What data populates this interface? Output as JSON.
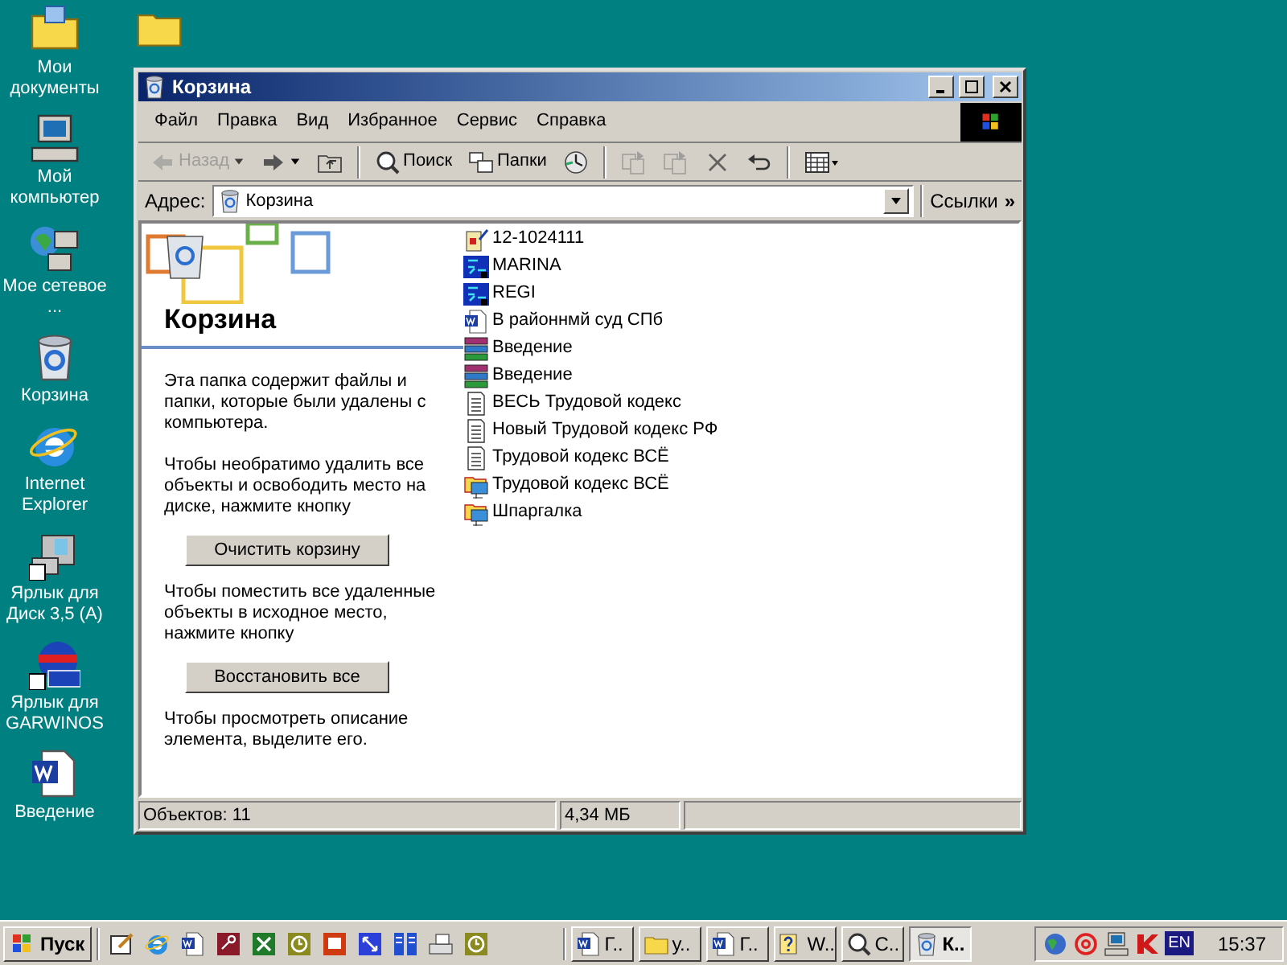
{
  "desktop_icons": [
    {
      "label": "Мои документы",
      "kind": "documents"
    },
    {
      "label": "Мой компьютер",
      "kind": "computer"
    },
    {
      "label": "Мое сетевое ...",
      "kind": "network"
    },
    {
      "label": "Корзина",
      "kind": "recycle"
    },
    {
      "label": "Internet Explorer",
      "kind": "ie"
    },
    {
      "label": "Ярлык для Диск 3,5 (A)",
      "kind": "floppy"
    },
    {
      "label": "Ярлык для GARWINOS",
      "kind": "garant"
    },
    {
      "label": "Введение",
      "kind": "word"
    }
  ],
  "desktop_folder": {
    "kind": "folder"
  },
  "window": {
    "title": "Корзина",
    "menu": [
      "Файл",
      "Правка",
      "Вид",
      "Избранное",
      "Сервис",
      "Справка"
    ],
    "toolbar": [
      {
        "kind": "back",
        "label": "Назад",
        "disabled": true
      },
      {
        "kind": "forward",
        "disabled": false
      },
      {
        "kind": "up",
        "disabled": false
      },
      {
        "kind": "sep"
      },
      {
        "kind": "search",
        "label": "Поиск",
        "disabled": false
      },
      {
        "kind": "folders",
        "label": "Папки",
        "disabled": false
      },
      {
        "kind": "history",
        "disabled": false
      },
      {
        "kind": "sep"
      },
      {
        "kind": "moveto",
        "disabled": true
      },
      {
        "kind": "copyto",
        "disabled": true
      },
      {
        "kind": "delete",
        "disabled": true
      },
      {
        "kind": "undo",
        "disabled": false
      },
      {
        "kind": "sep"
      },
      {
        "kind": "views",
        "disabled": false
      }
    ],
    "address": {
      "label": "Адрес:",
      "value": "Корзина"
    },
    "links": "Ссылки",
    "links_chevron": "»",
    "panel": {
      "heading": "Корзина",
      "blocks": [
        {
          "kind": "text",
          "text": "Эта папка содержит файлы и папки, которые были удалены с компьютера."
        },
        {
          "kind": "text",
          "text": "Чтобы необратимо удалить все объекты и освободить место на диске, нажмите кнопку"
        },
        {
          "kind": "button",
          "text": "Очистить корзину"
        },
        {
          "kind": "text",
          "text": "Чтобы поместить все удаленные объекты в исходное место, нажмите кнопку"
        },
        {
          "kind": "button",
          "text": "Восстановить все"
        },
        {
          "kind": "text",
          "text": "Чтобы просмотреть описание элемента, выделите его."
        }
      ]
    },
    "files": [
      {
        "name": "12-1024111",
        "kind": "shortcut"
      },
      {
        "name": "MARINA",
        "kind": "app"
      },
      {
        "name": "REGI",
        "kind": "app"
      },
      {
        "name": "В районнмй суд СПб",
        "kind": "word"
      },
      {
        "name": "Введение",
        "kind": "archive"
      },
      {
        "name": "Введение",
        "kind": "archive"
      },
      {
        "name": "ВЕСЬ Трудовой кодекс",
        "kind": "text"
      },
      {
        "name": "Новый Трудовой кодекс РФ",
        "kind": "text"
      },
      {
        "name": "Трудовой кодекс ВСЁ",
        "kind": "text"
      },
      {
        "name": "Трудовой кодекс ВСЁ",
        "kind": "netfolder"
      },
      {
        "name": "Шпаргалка",
        "kind": "netfolder"
      }
    ],
    "status": [
      "Объектов: 11",
      "4,34 МБ"
    ]
  },
  "taskbar": {
    "start": "Пуск",
    "quick_launch": [
      {
        "kind": "desktop"
      },
      {
        "kind": "ie"
      },
      {
        "kind": "word"
      },
      {
        "kind": "access"
      },
      {
        "kind": "excel"
      },
      {
        "kind": "clock"
      },
      {
        "kind": "powerpoint"
      },
      {
        "kind": "arrows"
      },
      {
        "kind": "books"
      },
      {
        "kind": "scanner"
      },
      {
        "kind": "clock"
      }
    ],
    "tasks": [
      {
        "label": "Г..",
        "kind": "word",
        "selected": false
      },
      {
        "label": "у..",
        "kind": "folder",
        "selected": false
      },
      {
        "label": "Г..",
        "kind": "word",
        "selected": false
      },
      {
        "label": "W..",
        "kind": "help",
        "selected": false
      },
      {
        "label": "С..",
        "kind": "search",
        "selected": false
      },
      {
        "label": "К..",
        "kind": "recycle",
        "selected": true
      }
    ],
    "tray": [
      {
        "kind": "globe"
      },
      {
        "kind": "at"
      },
      {
        "kind": "network"
      },
      {
        "kind": "antivirus"
      }
    ],
    "lang": "EN",
    "time": "15:37"
  }
}
